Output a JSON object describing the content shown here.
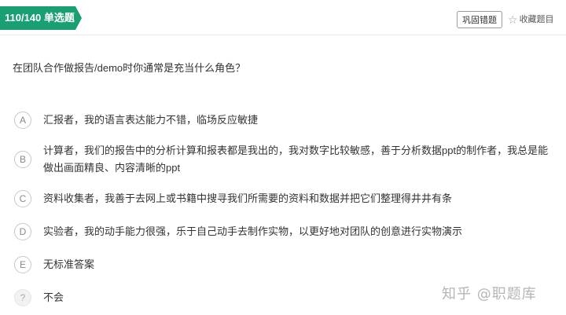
{
  "header": {
    "badge": "110/140 单选题",
    "practice_label": "巩固错题",
    "favorite_label": "收藏题目",
    "favorite_icon": "star-outline-icon"
  },
  "question": {
    "text": "在团队合作做报告/demo时你通常是充当什么角色？"
  },
  "options": [
    {
      "letter": "A",
      "text": "汇报者，我的语言表达能力不错，临场反应敏捷"
    },
    {
      "letter": "B",
      "text": "计算者，我们的报告中的分析计算和报表都是我出的，我对数字比较敏感，善于分析数据ppt的制作者，我总是能做出画面精良、内容清晰的ppt"
    },
    {
      "letter": "C",
      "text": "资料收集者，我善于去网上或书籍中搜寻我们所需要的资料和数据并把它们整理得井井有条"
    },
    {
      "letter": "D",
      "text": "实验者，我的动手能力很强，乐于自己动手去制作实物，以更好地对团队的创意进行实物演示"
    },
    {
      "letter": "E",
      "text": "无标准答案"
    },
    {
      "letter": "?",
      "text": "不会"
    }
  ],
  "watermark": "知乎 @职题库",
  "colors": {
    "accent": "#1a9e73"
  }
}
